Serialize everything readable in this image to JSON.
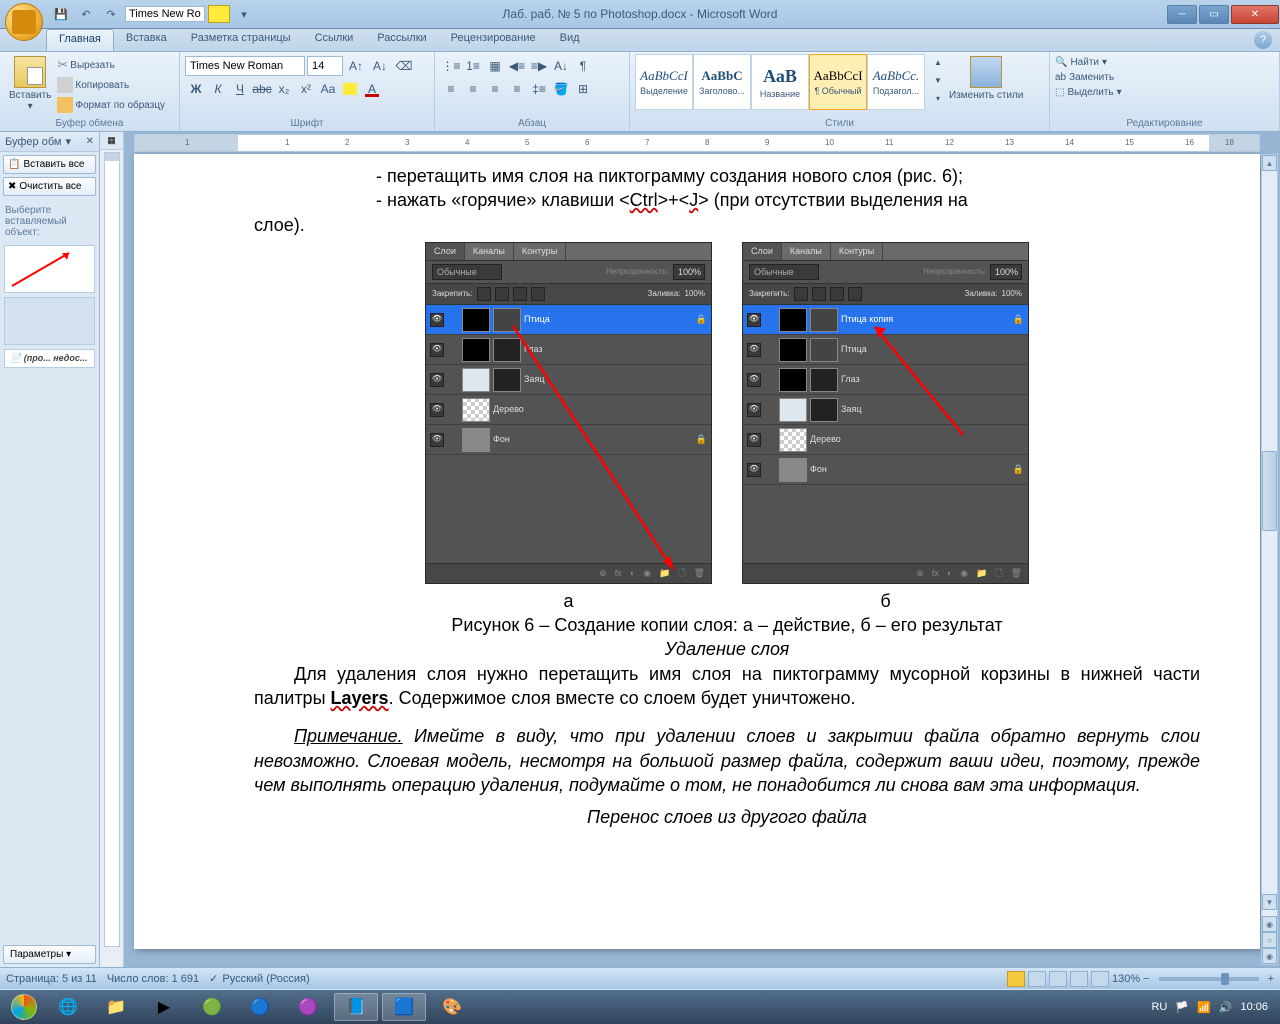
{
  "window": {
    "title": "Лаб. раб. № 5 по Photoshop.docx - Microsoft Word",
    "qat_font": "Times New Ro"
  },
  "ribbon": {
    "tabs": [
      "Главная",
      "Вставка",
      "Разметка страницы",
      "Ссылки",
      "Рассылки",
      "Рецензирование",
      "Вид"
    ],
    "clipboard": {
      "label": "Буфер обмена",
      "paste": "Вставить",
      "cut": "Вырезать",
      "copy": "Копировать",
      "format": "Формат по образцу"
    },
    "font": {
      "label": "Шрифт",
      "name": "Times New Roman",
      "size": "14"
    },
    "paragraph": {
      "label": "Абзац"
    },
    "styles": {
      "label": "Стили",
      "items": [
        {
          "sample": "AaBbCcI",
          "name": "Выделение"
        },
        {
          "sample": "AaBbC",
          "name": "Заголово..."
        },
        {
          "sample": "АаВ",
          "name": "Название"
        },
        {
          "sample": "AaBbCcI",
          "name": "¶ Обычный"
        },
        {
          "sample": "AaBbCc.",
          "name": "Подзагол..."
        }
      ],
      "change": "Изменить стили"
    },
    "editing": {
      "label": "Редактирование",
      "find": "Найти",
      "replace": "Заменить",
      "select": "Выделить"
    }
  },
  "clipboardPane": {
    "title": "Буфер обм",
    "pasteAll": "Вставить все",
    "clearAll": "Очистить все",
    "note": "Выберите вставляемый объект:",
    "item3": "(про... недос...",
    "params": "Параметры"
  },
  "document": {
    "li1": "перетащить имя слоя на пиктограмму создания нового слоя (рис. 6);",
    "li2_a": "нажать «горячие» клавиши <",
    "li2_ctrl": "Ctrl",
    "li2_b": ">+<",
    "li2_j": "J",
    "li2_c": "> (при отсутствии выделения на",
    "li2_end": "слое).",
    "label_a": "а",
    "label_b": "б",
    "caption6": "Рисунок 6 – Создание копии слоя: а – действие, б – его результат",
    "del_title": "Удаление слоя",
    "del_p_a": "Для удаления слоя нужно перетащить имя слоя на пиктограмму мусорной корзины в нижней части палитры ",
    "del_layers": "Layers",
    "del_p_b": ". Содержимое слоя вместе со слоем будет уничтожено.",
    "note_label": "Примечание.",
    "note_text": " Имейте в виду, что при удалении слоев и закрытии файла обратно вернуть слои невозможно. Слоевая модель, несмотря на большой размер файла, содержит ваши идеи, поэтому, прежде чем выполнять операцию удаления, подумайте о том, не понадобится ли снова вам эта информация.",
    "transfer_title": "Перенос слоев из другого файла"
  },
  "psPanel": {
    "tabs": [
      "Слои",
      "Каналы",
      "Контуры"
    ],
    "mode": "Обычные",
    "opacity_lbl": "Непрозрачность:",
    "opacity": "100%",
    "lock_lbl": "Закрепить:",
    "fill_lbl": "Заливка:",
    "fill": "100%",
    "layersA": [
      "Птица",
      "Глаз",
      "Заяц",
      "Дерево",
      "Фон"
    ],
    "layersB": [
      "Птица копия",
      "Птица",
      "Глаз",
      "Заяц",
      "Дерево",
      "Фон"
    ]
  },
  "status": {
    "page": "Страница: 5 из 11",
    "words": "Число слов: 1 691",
    "lang": "Русский (Россия)",
    "zoom": "130%"
  },
  "taskbar": {
    "lang": "RU",
    "time": "10:06"
  }
}
